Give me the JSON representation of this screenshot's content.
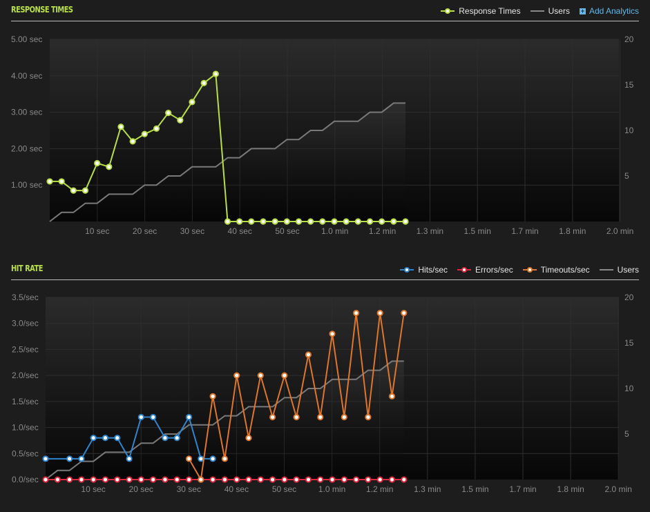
{
  "response_times": {
    "title": "RESPONSE TIMES",
    "legend": {
      "response_times": "Response Times",
      "users": "Users",
      "add_analytics": "Add Analytics"
    },
    "colors": {
      "response": "#b8e046",
      "users": "#7a7a7a",
      "accent": "#62b7e8"
    }
  },
  "hit_rate": {
    "title": "HIT RATE",
    "legend": {
      "hits": "Hits/sec",
      "errors": "Errors/sec",
      "timeouts": "Timeouts/sec",
      "users": "Users"
    },
    "colors": {
      "hits": "#2f86d0",
      "errors": "#e0263a",
      "timeouts": "#e0762a",
      "users": "#7a7a7a"
    }
  },
  "chart_data": [
    {
      "type": "line",
      "title": "RESPONSE TIMES",
      "x_tick_labels": [
        "10 sec",
        "20 sec",
        "30 sec",
        "40 sec",
        "50 sec",
        "1.0 min",
        "1.2 min",
        "1.3 min",
        "1.5 min",
        "1.7 min",
        "1.8 min",
        "2.0 min"
      ],
      "y_tick_labels": [
        "5.00 sec",
        "4.00 sec",
        "3.00 sec",
        "2.00 sec",
        "1.00 sec"
      ],
      "y2_tick_labels": [
        "20",
        "15",
        "10",
        "5"
      ],
      "ylim": [
        0,
        5
      ],
      "y2lim": [
        0,
        20
      ],
      "xlim": [
        0,
        120
      ],
      "grid": true,
      "legend_position": "top-right",
      "series": [
        {
          "name": "Response Times",
          "axis": "left",
          "x": [
            0,
            2.5,
            5,
            7.5,
            10,
            12.5,
            15,
            17.5,
            20,
            22.5,
            25,
            27.5,
            30,
            32.5,
            35,
            37.5,
            40,
            42.5,
            45,
            47.5,
            50,
            52.5,
            55,
            57.5,
            60,
            62.5,
            65,
            67.5,
            70,
            72.5,
            75
          ],
          "values": [
            1.1,
            1.1,
            0.85,
            0.85,
            1.6,
            1.5,
            2.6,
            2.2,
            2.4,
            2.55,
            2.98,
            2.78,
            3.28,
            3.8,
            4.05,
            0.0,
            0.0,
            0.0,
            0.0,
            0.0,
            0.0,
            0.0,
            0.0,
            0.0,
            0.0,
            0.0,
            0.0,
            0.0,
            0.0,
            0.0,
            0.0
          ]
        },
        {
          "name": "Users",
          "axis": "right",
          "x": [
            0,
            2.5,
            5,
            7.5,
            10,
            12.5,
            15,
            17.5,
            20,
            22.5,
            25,
            27.5,
            30,
            32.5,
            35,
            37.5,
            40,
            42.5,
            45,
            47.5,
            50,
            52.5,
            55,
            57.5,
            60,
            62.5,
            65,
            67.5,
            70,
            72.5,
            75
          ],
          "values": [
            0,
            1,
            1,
            2,
            2,
            3,
            3,
            3,
            4,
            4,
            5,
            5,
            6,
            6,
            6,
            7,
            7,
            8,
            8,
            8,
            9,
            9,
            10,
            10,
            11,
            11,
            11,
            12,
            12,
            13,
            13
          ]
        }
      ]
    },
    {
      "type": "line",
      "title": "HIT RATE",
      "x_tick_labels": [
        "10 sec",
        "20 sec",
        "30 sec",
        "40 sec",
        "50 sec",
        "1.0 min",
        "1.2 min",
        "1.3 min",
        "1.5 min",
        "1.7 min",
        "1.8 min",
        "2.0 min"
      ],
      "y_tick_labels": [
        "3.5/sec",
        "3.0/sec",
        "2.5/sec",
        "2.0/sec",
        "1.5/sec",
        "1.0/sec",
        "0.5/sec",
        "0.0/sec"
      ],
      "y2_tick_labels": [
        "20",
        "15",
        "10",
        "5"
      ],
      "ylim": [
        0,
        3.5
      ],
      "y2lim": [
        0,
        20
      ],
      "xlim": [
        0,
        120
      ],
      "grid": true,
      "legend_position": "top-right",
      "series": [
        {
          "name": "Hits/sec",
          "axis": "left",
          "x": [
            0,
            5,
            7.5,
            10,
            12.5,
            15,
            17.5,
            20,
            22.5,
            25,
            27.5,
            30,
            32.5,
            35
          ],
          "values": [
            0.4,
            0.4,
            0.4,
            0.8,
            0.8,
            0.8,
            0.4,
            1.2,
            1.2,
            0.8,
            0.8,
            1.2,
            0.4,
            0.4
          ]
        },
        {
          "name": "Errors/sec",
          "axis": "left",
          "x": [
            0,
            2.5,
            5,
            7.5,
            10,
            12.5,
            15,
            17.5,
            20,
            22.5,
            25,
            27.5,
            30,
            32.5,
            35,
            37.5,
            40,
            42.5,
            45,
            47.5,
            50,
            52.5,
            55,
            57.5,
            60,
            62.5,
            65,
            67.5,
            70,
            72.5,
            75
          ],
          "values": [
            0,
            0,
            0,
            0,
            0,
            0,
            0,
            0,
            0,
            0,
            0,
            0,
            0,
            0,
            0,
            0,
            0,
            0,
            0,
            0,
            0,
            0,
            0,
            0,
            0,
            0,
            0,
            0,
            0,
            0,
            0
          ]
        },
        {
          "name": "Timeouts/sec",
          "axis": "left",
          "x": [
            30,
            32.5,
            35,
            37.5,
            40,
            42.5,
            45,
            47.5,
            50,
            52.5,
            55,
            57.5,
            60,
            62.5,
            65,
            67.5,
            70,
            72.5,
            75
          ],
          "values": [
            0.4,
            0.0,
            1.6,
            0.4,
            2.0,
            0.8,
            2.0,
            1.2,
            2.0,
            1.2,
            2.4,
            1.2,
            2.8,
            1.2,
            3.2,
            1.2,
            3.2,
            1.6,
            3.2
          ]
        },
        {
          "name": "Users",
          "axis": "right",
          "x": [
            0,
            2.5,
            5,
            7.5,
            10,
            12.5,
            15,
            17.5,
            20,
            22.5,
            25,
            27.5,
            30,
            32.5,
            35,
            37.5,
            40,
            42.5,
            45,
            47.5,
            50,
            52.5,
            55,
            57.5,
            60,
            62.5,
            65,
            67.5,
            70,
            72.5,
            75
          ],
          "values": [
            0,
            1,
            1,
            2,
            2,
            3,
            3,
            3,
            4,
            4,
            5,
            5,
            6,
            6,
            6,
            7,
            7,
            8,
            8,
            8,
            9,
            9,
            10,
            10,
            11,
            11,
            11,
            12,
            12,
            13,
            13
          ]
        }
      ]
    }
  ]
}
